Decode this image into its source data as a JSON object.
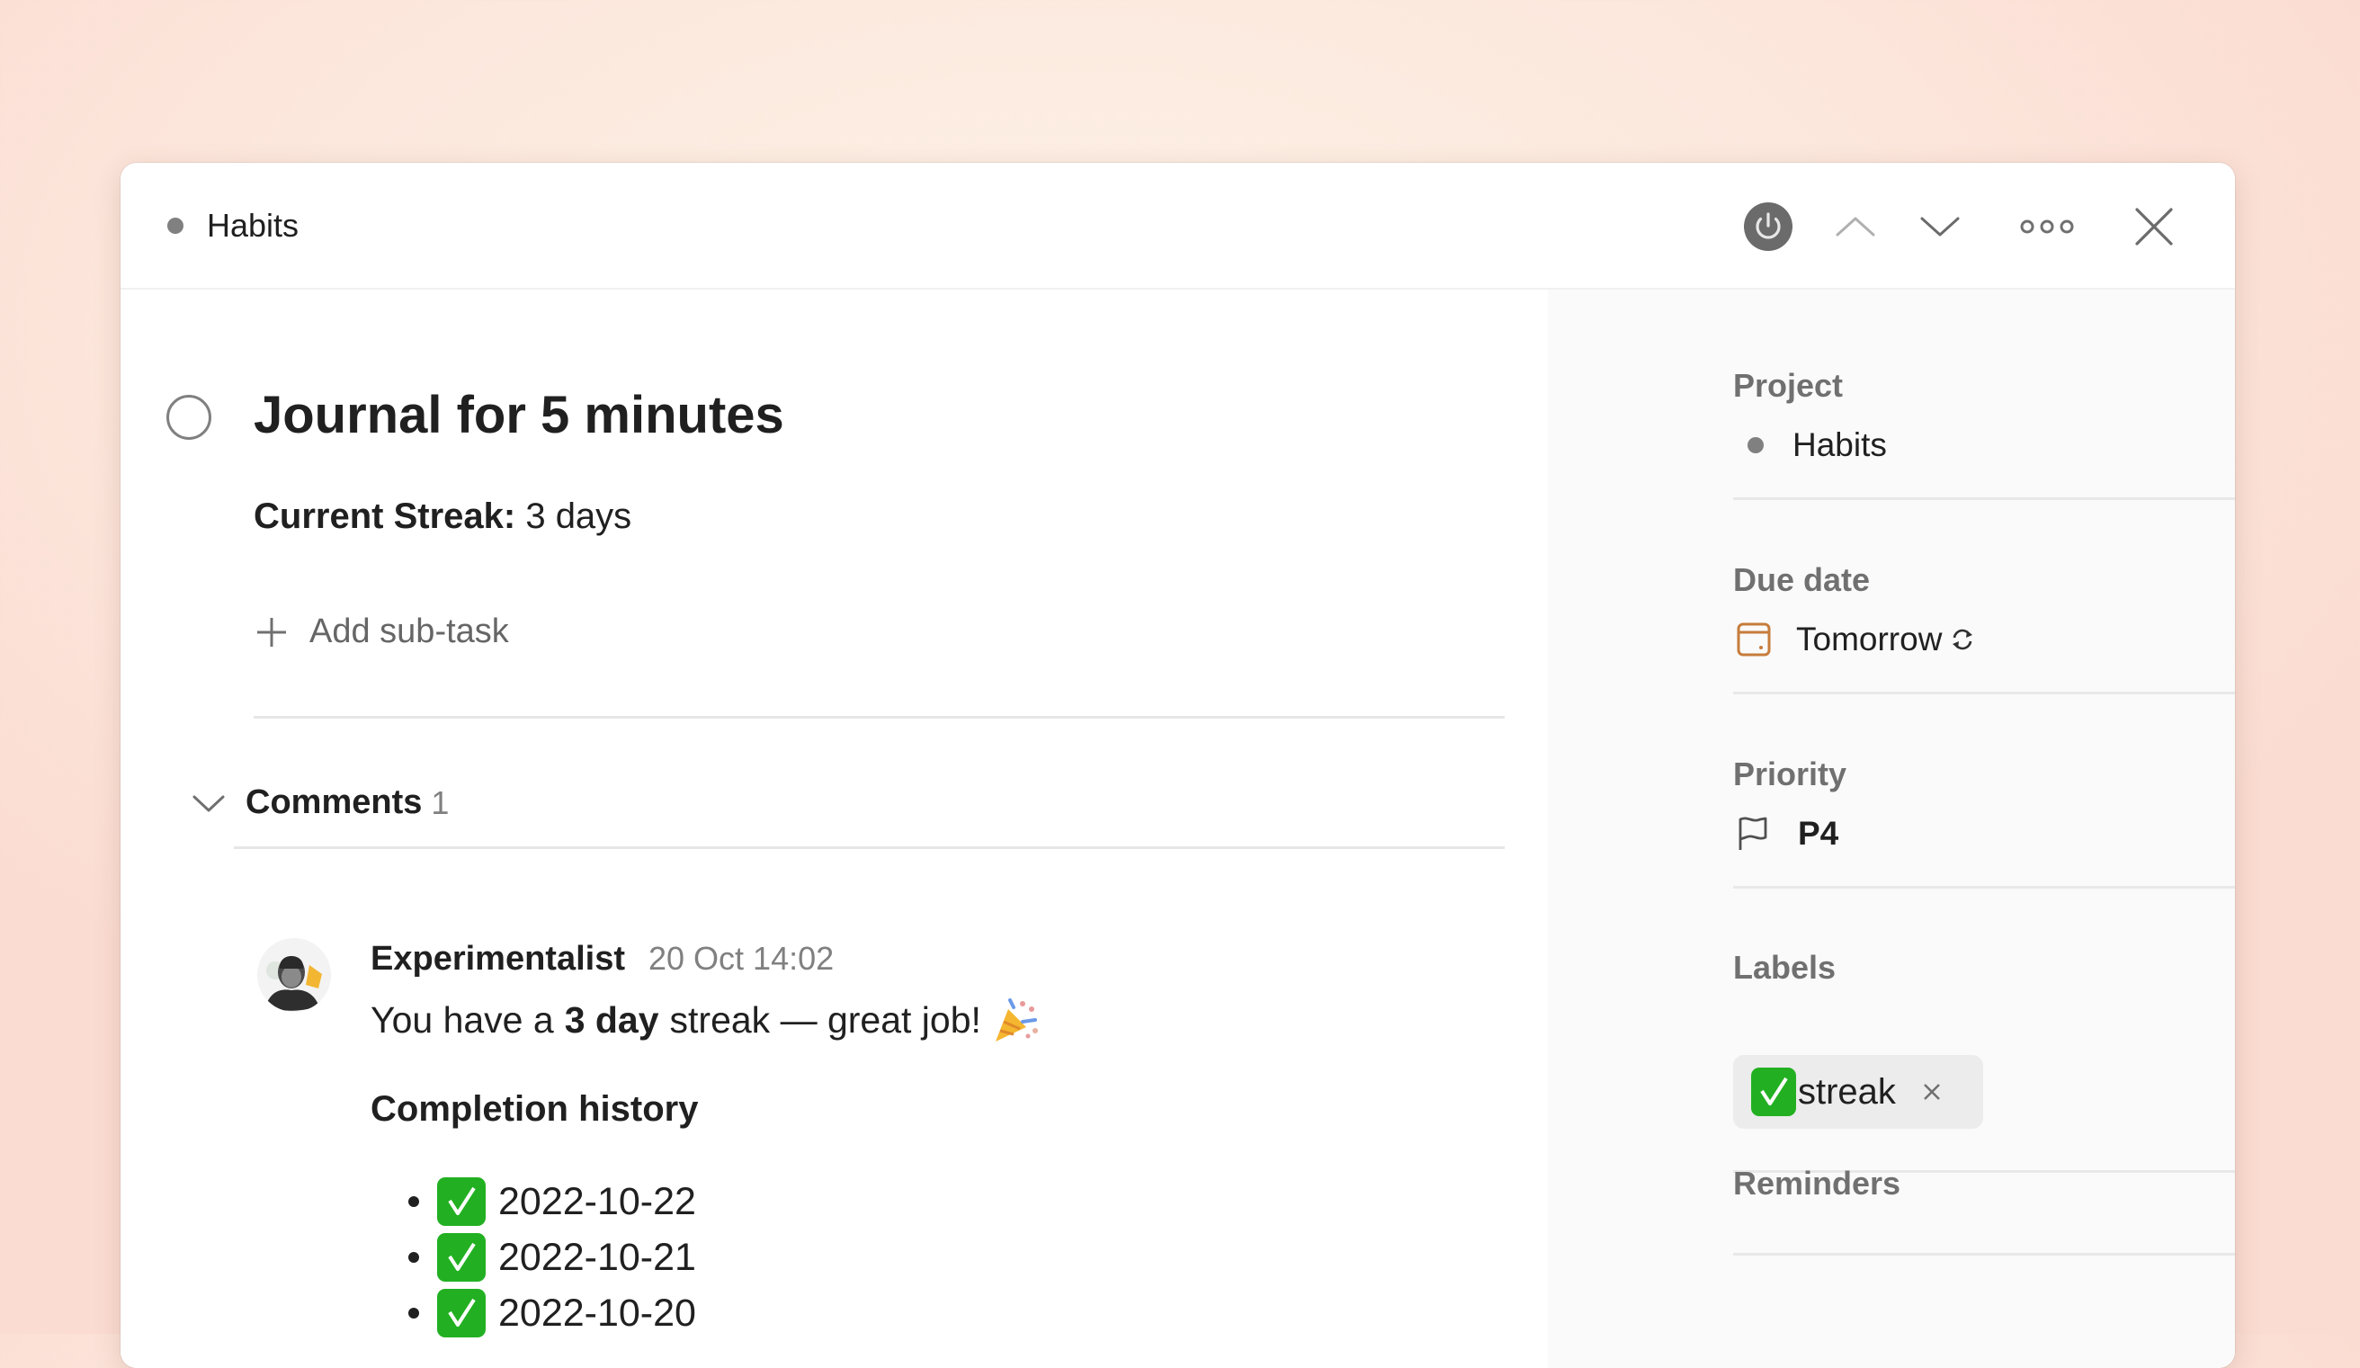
{
  "header": {
    "breadcrumb_project": "Habits",
    "icons": [
      "power-icon",
      "chevron-up-icon",
      "chevron-down-icon",
      "more-icon",
      "close-icon"
    ]
  },
  "task": {
    "title": "Journal for 5 minutes",
    "streak_label": "Current Streak:",
    "streak_value": "3 days",
    "add_subtask": "Add sub-task"
  },
  "comments": {
    "label": "Comments",
    "count": "1",
    "items": [
      {
        "author": "Experimentalist",
        "timestamp": "20 Oct 14:02",
        "text_pre": "You have a",
        "text_bold": "3 day",
        "text_post": "streak — great job!",
        "emoji": "party-popper",
        "history_title": "Completion history",
        "history": [
          "2022-10-22",
          "2022-10-21",
          "2022-10-20"
        ]
      }
    ]
  },
  "sidebar": {
    "project": {
      "label": "Project",
      "value": "Habits"
    },
    "due_date": {
      "label": "Due date",
      "value": "Tomorrow",
      "recurring": true
    },
    "priority": {
      "label": "Priority",
      "value": "P4"
    },
    "labels": {
      "label": "Labels",
      "items": [
        {
          "name": "streak",
          "emoji": "check-mark-button"
        }
      ]
    },
    "reminders": {
      "label": "Reminders"
    }
  },
  "colors": {
    "project_dot": "#808080",
    "due_date_icon": "#c77c3b",
    "check_green": "#22b022",
    "sidebar_bg": "#fafafa"
  }
}
